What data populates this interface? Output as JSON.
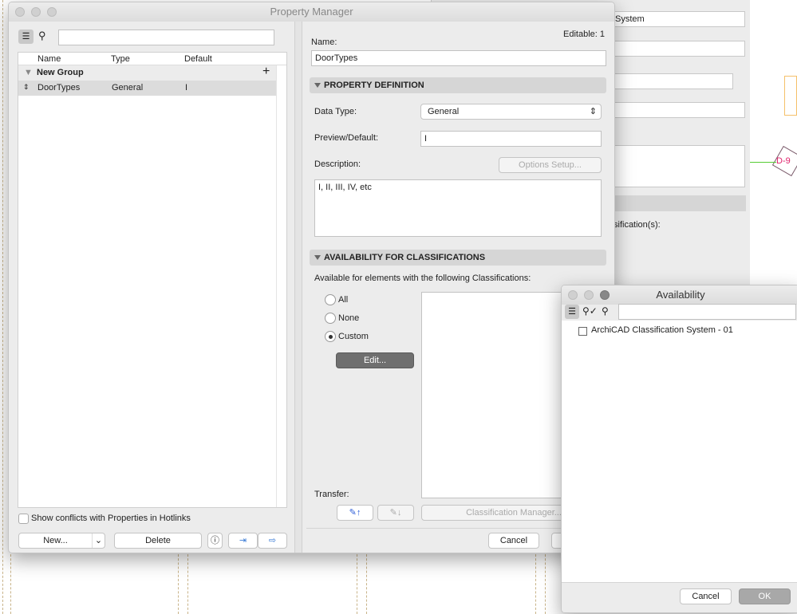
{
  "background": {
    "field1": "System",
    "label_classifications": "sification(s):",
    "tag": "D-9"
  },
  "property_manager": {
    "title": "Property Manager",
    "search_placeholder": "",
    "columns": [
      "Name",
      "Type",
      "Default"
    ],
    "group": {
      "name": "New Group"
    },
    "rows": [
      {
        "name": "DoorTypes",
        "type": "General",
        "default": "I"
      }
    ],
    "show_conflicts_label": "Show conflicts with Properties in Hotlinks",
    "show_conflicts_checked": false,
    "new_label": "New...",
    "delete_label": "Delete",
    "editable": "Editable: 1",
    "name_label": "Name:",
    "name_value": "DoorTypes",
    "property_definition": "PROPERTY DEFINITION",
    "data_type_label": "Data Type:",
    "data_type_value": "General",
    "preview_label": "Preview/Default:",
    "preview_value": "I",
    "description_label": "Description:",
    "options_setup": "Options Setup...",
    "description_value": "I, II, III, IV, etc",
    "availability_section": "AVAILABILITY FOR CLASSIFICATIONS",
    "available_text": "Available for elements with the following Classifications:",
    "radio_all": "All",
    "radio_none": "None",
    "radio_custom": "Custom",
    "selected_radio": "Custom",
    "edit_label": "Edit...",
    "transfer_label": "Transfer:",
    "classification_manager": "Classification Manager...",
    "cancel_label": "Cancel"
  },
  "availability": {
    "title": "Availability",
    "search_placeholder": "",
    "items": [
      {
        "label": "ArchiCAD Classification System - 01",
        "checked": false
      }
    ],
    "cancel_label": "Cancel",
    "ok_label": "OK"
  }
}
